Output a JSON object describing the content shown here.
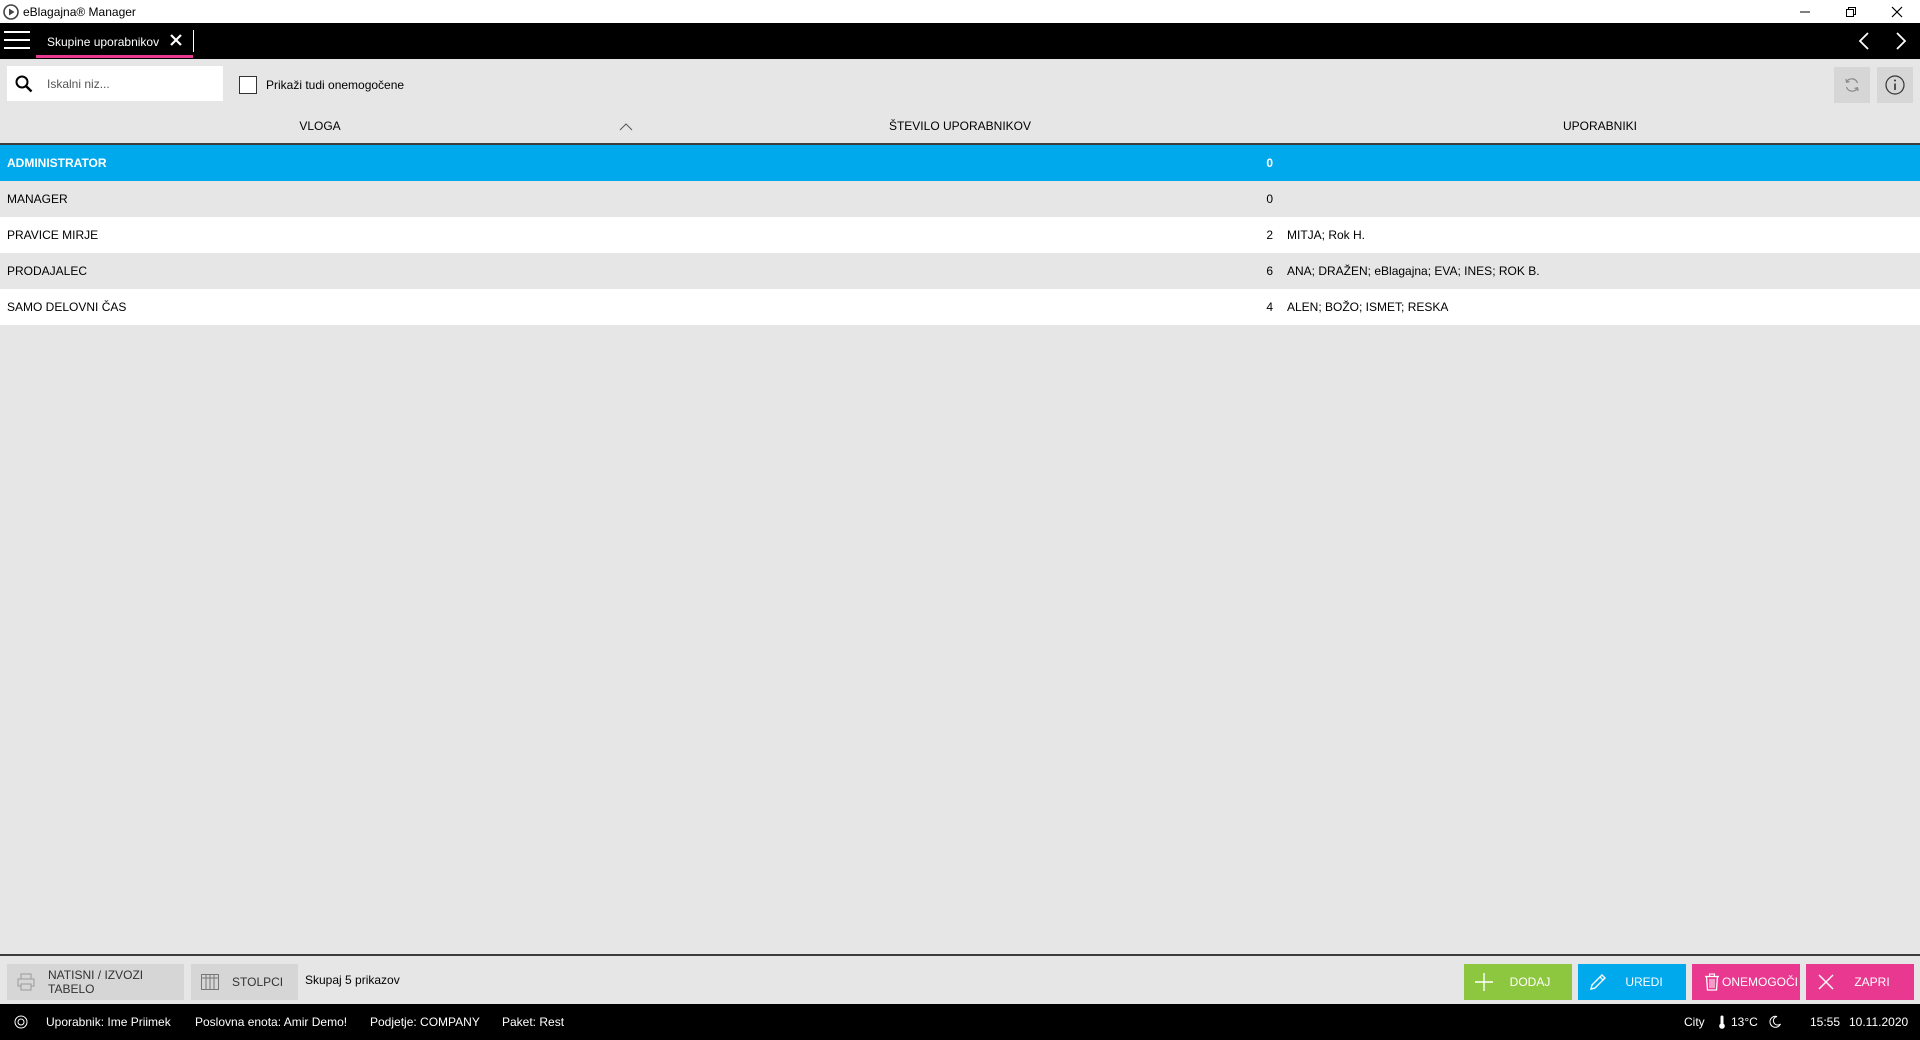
{
  "window": {
    "title": "eBlagajna® Manager"
  },
  "tabs": [
    {
      "label": "Skupine uporabnikov"
    }
  ],
  "toolbar": {
    "search_placeholder": "Iskalni niz...",
    "show_disabled_label": "Prikaži tudi onemogočene",
    "show_disabled_checked": false
  },
  "table": {
    "columns": [
      "VLOGA",
      "ŠTEVILO UPORABNIKOV",
      "UPORABNIKI"
    ],
    "sorted_column": "VLOGA",
    "sort_direction": "asc",
    "selected_row": 0,
    "rows": [
      {
        "role": "ADMINISTRATOR",
        "count": "0",
        "users": ""
      },
      {
        "role": "MANAGER",
        "count": "0",
        "users": ""
      },
      {
        "role": "PRAVICE MIRJE",
        "count": "2",
        "users": "MITJA; Rok H."
      },
      {
        "role": "PRODAJALEC",
        "count": "6",
        "users": "ANA; DRAŽEN; eBlagajna; EVA; INES; ROK B."
      },
      {
        "role": "SAMO DELOVNI ČAS",
        "count": "4",
        "users": "ALEN; BOŽO; ISMET; RESKA"
      }
    ]
  },
  "actions": {
    "print_export_label": "NATISNI / IZVOZI TABELO",
    "columns_label": "STOLPCI",
    "total_label": "Skupaj 5 prikazov",
    "add_label": "DODAJ",
    "edit_label": "UREDI",
    "disable_label": "ONEMOGOČI",
    "close_label": "ZAPRI"
  },
  "status": {
    "user": "Uporabnik: Ime Priimek",
    "business_unit": "Poslovna enota: Amir Demo!",
    "company": "Podjetje: COMPANY",
    "package": "Paket: Rest",
    "city": "City",
    "temperature": "13°C",
    "time": "15:55",
    "date": "10.11.2020"
  },
  "colors": {
    "selected_row": "#00a8ec",
    "tab_accent": "#e8388f",
    "add": "#8dc63f",
    "edit": "#00a8ec",
    "disable": "#e8388f",
    "close": "#e8388f"
  }
}
